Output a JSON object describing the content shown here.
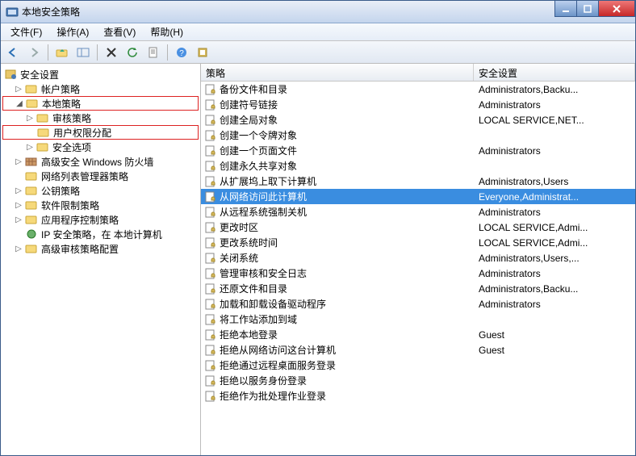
{
  "window": {
    "title": "本地安全策略"
  },
  "menu": {
    "file": "文件(F)",
    "action": "操作(A)",
    "view": "查看(V)",
    "help": "帮助(H)"
  },
  "tree": {
    "root": "安全设置",
    "account_policies": "帐户策略",
    "local_policies": "本地策略",
    "audit_policy": "审核策略",
    "user_rights": "用户权限分配",
    "security_options": "安全选项",
    "advanced_firewall": "高级安全 Windows 防火墙",
    "nlm_policies": "网络列表管理器策略",
    "pubkey_policies": "公钥策略",
    "software_restriction": "软件限制策略",
    "app_control": "应用程序控制策略",
    "ipsec": "IP 安全策略，在 本地计算机",
    "advanced_audit": "高级审核策略配置"
  },
  "list": {
    "col_policy": "策略",
    "col_setting": "安全设置",
    "rows": [
      {
        "p": "备份文件和目录",
        "s": "Administrators,Backu..."
      },
      {
        "p": "创建符号链接",
        "s": "Administrators"
      },
      {
        "p": "创建全局对象",
        "s": "LOCAL SERVICE,NET..."
      },
      {
        "p": "创建一个令牌对象",
        "s": ""
      },
      {
        "p": "创建一个页面文件",
        "s": "Administrators"
      },
      {
        "p": "创建永久共享对象",
        "s": ""
      },
      {
        "p": "从扩展坞上取下计算机",
        "s": "Administrators,Users"
      },
      {
        "p": "从网络访问此计算机",
        "s": "Everyone,Administrat...",
        "sel": true
      },
      {
        "p": "从远程系统强制关机",
        "s": "Administrators"
      },
      {
        "p": "更改时区",
        "s": "LOCAL SERVICE,Admi..."
      },
      {
        "p": "更改系统时间",
        "s": "LOCAL SERVICE,Admi..."
      },
      {
        "p": "关闭系统",
        "s": "Administrators,Users,..."
      },
      {
        "p": "管理审核和安全日志",
        "s": "Administrators"
      },
      {
        "p": "还原文件和目录",
        "s": "Administrators,Backu..."
      },
      {
        "p": "加载和卸载设备驱动程序",
        "s": "Administrators"
      },
      {
        "p": "将工作站添加到域",
        "s": ""
      },
      {
        "p": "拒绝本地登录",
        "s": "Guest"
      },
      {
        "p": "拒绝从网络访问这台计算机",
        "s": "Guest"
      },
      {
        "p": "拒绝通过远程桌面服务登录",
        "s": ""
      },
      {
        "p": "拒绝以服务身份登录",
        "s": ""
      },
      {
        "p": "拒绝作为批处理作业登录",
        "s": ""
      }
    ]
  }
}
